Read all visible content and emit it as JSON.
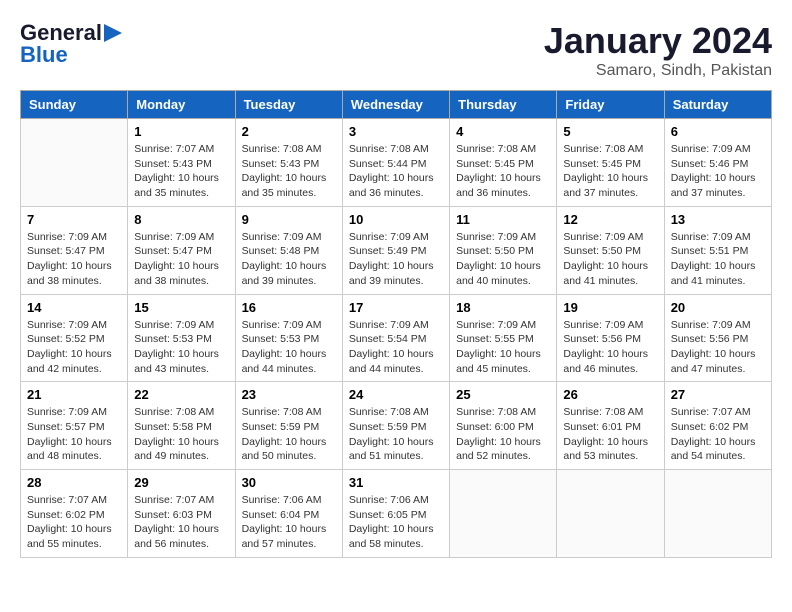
{
  "header": {
    "logo_line1": "General",
    "logo_line2": "Blue",
    "title": "January 2024",
    "subtitle": "Samaro, Sindh, Pakistan"
  },
  "calendar": {
    "days_of_week": [
      "Sunday",
      "Monday",
      "Tuesday",
      "Wednesday",
      "Thursday",
      "Friday",
      "Saturday"
    ],
    "weeks": [
      [
        {
          "day": "",
          "info": ""
        },
        {
          "day": "1",
          "info": "Sunrise: 7:07 AM\nSunset: 5:43 PM\nDaylight: 10 hours\nand 35 minutes."
        },
        {
          "day": "2",
          "info": "Sunrise: 7:08 AM\nSunset: 5:43 PM\nDaylight: 10 hours\nand 35 minutes."
        },
        {
          "day": "3",
          "info": "Sunrise: 7:08 AM\nSunset: 5:44 PM\nDaylight: 10 hours\nand 36 minutes."
        },
        {
          "day": "4",
          "info": "Sunrise: 7:08 AM\nSunset: 5:45 PM\nDaylight: 10 hours\nand 36 minutes."
        },
        {
          "day": "5",
          "info": "Sunrise: 7:08 AM\nSunset: 5:45 PM\nDaylight: 10 hours\nand 37 minutes."
        },
        {
          "day": "6",
          "info": "Sunrise: 7:09 AM\nSunset: 5:46 PM\nDaylight: 10 hours\nand 37 minutes."
        }
      ],
      [
        {
          "day": "7",
          "info": "Sunrise: 7:09 AM\nSunset: 5:47 PM\nDaylight: 10 hours\nand 38 minutes."
        },
        {
          "day": "8",
          "info": "Sunrise: 7:09 AM\nSunset: 5:47 PM\nDaylight: 10 hours\nand 38 minutes."
        },
        {
          "day": "9",
          "info": "Sunrise: 7:09 AM\nSunset: 5:48 PM\nDaylight: 10 hours\nand 39 minutes."
        },
        {
          "day": "10",
          "info": "Sunrise: 7:09 AM\nSunset: 5:49 PM\nDaylight: 10 hours\nand 39 minutes."
        },
        {
          "day": "11",
          "info": "Sunrise: 7:09 AM\nSunset: 5:50 PM\nDaylight: 10 hours\nand 40 minutes."
        },
        {
          "day": "12",
          "info": "Sunrise: 7:09 AM\nSunset: 5:50 PM\nDaylight: 10 hours\nand 41 minutes."
        },
        {
          "day": "13",
          "info": "Sunrise: 7:09 AM\nSunset: 5:51 PM\nDaylight: 10 hours\nand 41 minutes."
        }
      ],
      [
        {
          "day": "14",
          "info": "Sunrise: 7:09 AM\nSunset: 5:52 PM\nDaylight: 10 hours\nand 42 minutes."
        },
        {
          "day": "15",
          "info": "Sunrise: 7:09 AM\nSunset: 5:53 PM\nDaylight: 10 hours\nand 43 minutes."
        },
        {
          "day": "16",
          "info": "Sunrise: 7:09 AM\nSunset: 5:53 PM\nDaylight: 10 hours\nand 44 minutes."
        },
        {
          "day": "17",
          "info": "Sunrise: 7:09 AM\nSunset: 5:54 PM\nDaylight: 10 hours\nand 44 minutes."
        },
        {
          "day": "18",
          "info": "Sunrise: 7:09 AM\nSunset: 5:55 PM\nDaylight: 10 hours\nand 45 minutes."
        },
        {
          "day": "19",
          "info": "Sunrise: 7:09 AM\nSunset: 5:56 PM\nDaylight: 10 hours\nand 46 minutes."
        },
        {
          "day": "20",
          "info": "Sunrise: 7:09 AM\nSunset: 5:56 PM\nDaylight: 10 hours\nand 47 minutes."
        }
      ],
      [
        {
          "day": "21",
          "info": "Sunrise: 7:09 AM\nSunset: 5:57 PM\nDaylight: 10 hours\nand 48 minutes."
        },
        {
          "day": "22",
          "info": "Sunrise: 7:08 AM\nSunset: 5:58 PM\nDaylight: 10 hours\nand 49 minutes."
        },
        {
          "day": "23",
          "info": "Sunrise: 7:08 AM\nSunset: 5:59 PM\nDaylight: 10 hours\nand 50 minutes."
        },
        {
          "day": "24",
          "info": "Sunrise: 7:08 AM\nSunset: 5:59 PM\nDaylight: 10 hours\nand 51 minutes."
        },
        {
          "day": "25",
          "info": "Sunrise: 7:08 AM\nSunset: 6:00 PM\nDaylight: 10 hours\nand 52 minutes."
        },
        {
          "day": "26",
          "info": "Sunrise: 7:08 AM\nSunset: 6:01 PM\nDaylight: 10 hours\nand 53 minutes."
        },
        {
          "day": "27",
          "info": "Sunrise: 7:07 AM\nSunset: 6:02 PM\nDaylight: 10 hours\nand 54 minutes."
        }
      ],
      [
        {
          "day": "28",
          "info": "Sunrise: 7:07 AM\nSunset: 6:02 PM\nDaylight: 10 hours\nand 55 minutes."
        },
        {
          "day": "29",
          "info": "Sunrise: 7:07 AM\nSunset: 6:03 PM\nDaylight: 10 hours\nand 56 minutes."
        },
        {
          "day": "30",
          "info": "Sunrise: 7:06 AM\nSunset: 6:04 PM\nDaylight: 10 hours\nand 57 minutes."
        },
        {
          "day": "31",
          "info": "Sunrise: 7:06 AM\nSunset: 6:05 PM\nDaylight: 10 hours\nand 58 minutes."
        },
        {
          "day": "",
          "info": ""
        },
        {
          "day": "",
          "info": ""
        },
        {
          "day": "",
          "info": ""
        }
      ]
    ]
  }
}
